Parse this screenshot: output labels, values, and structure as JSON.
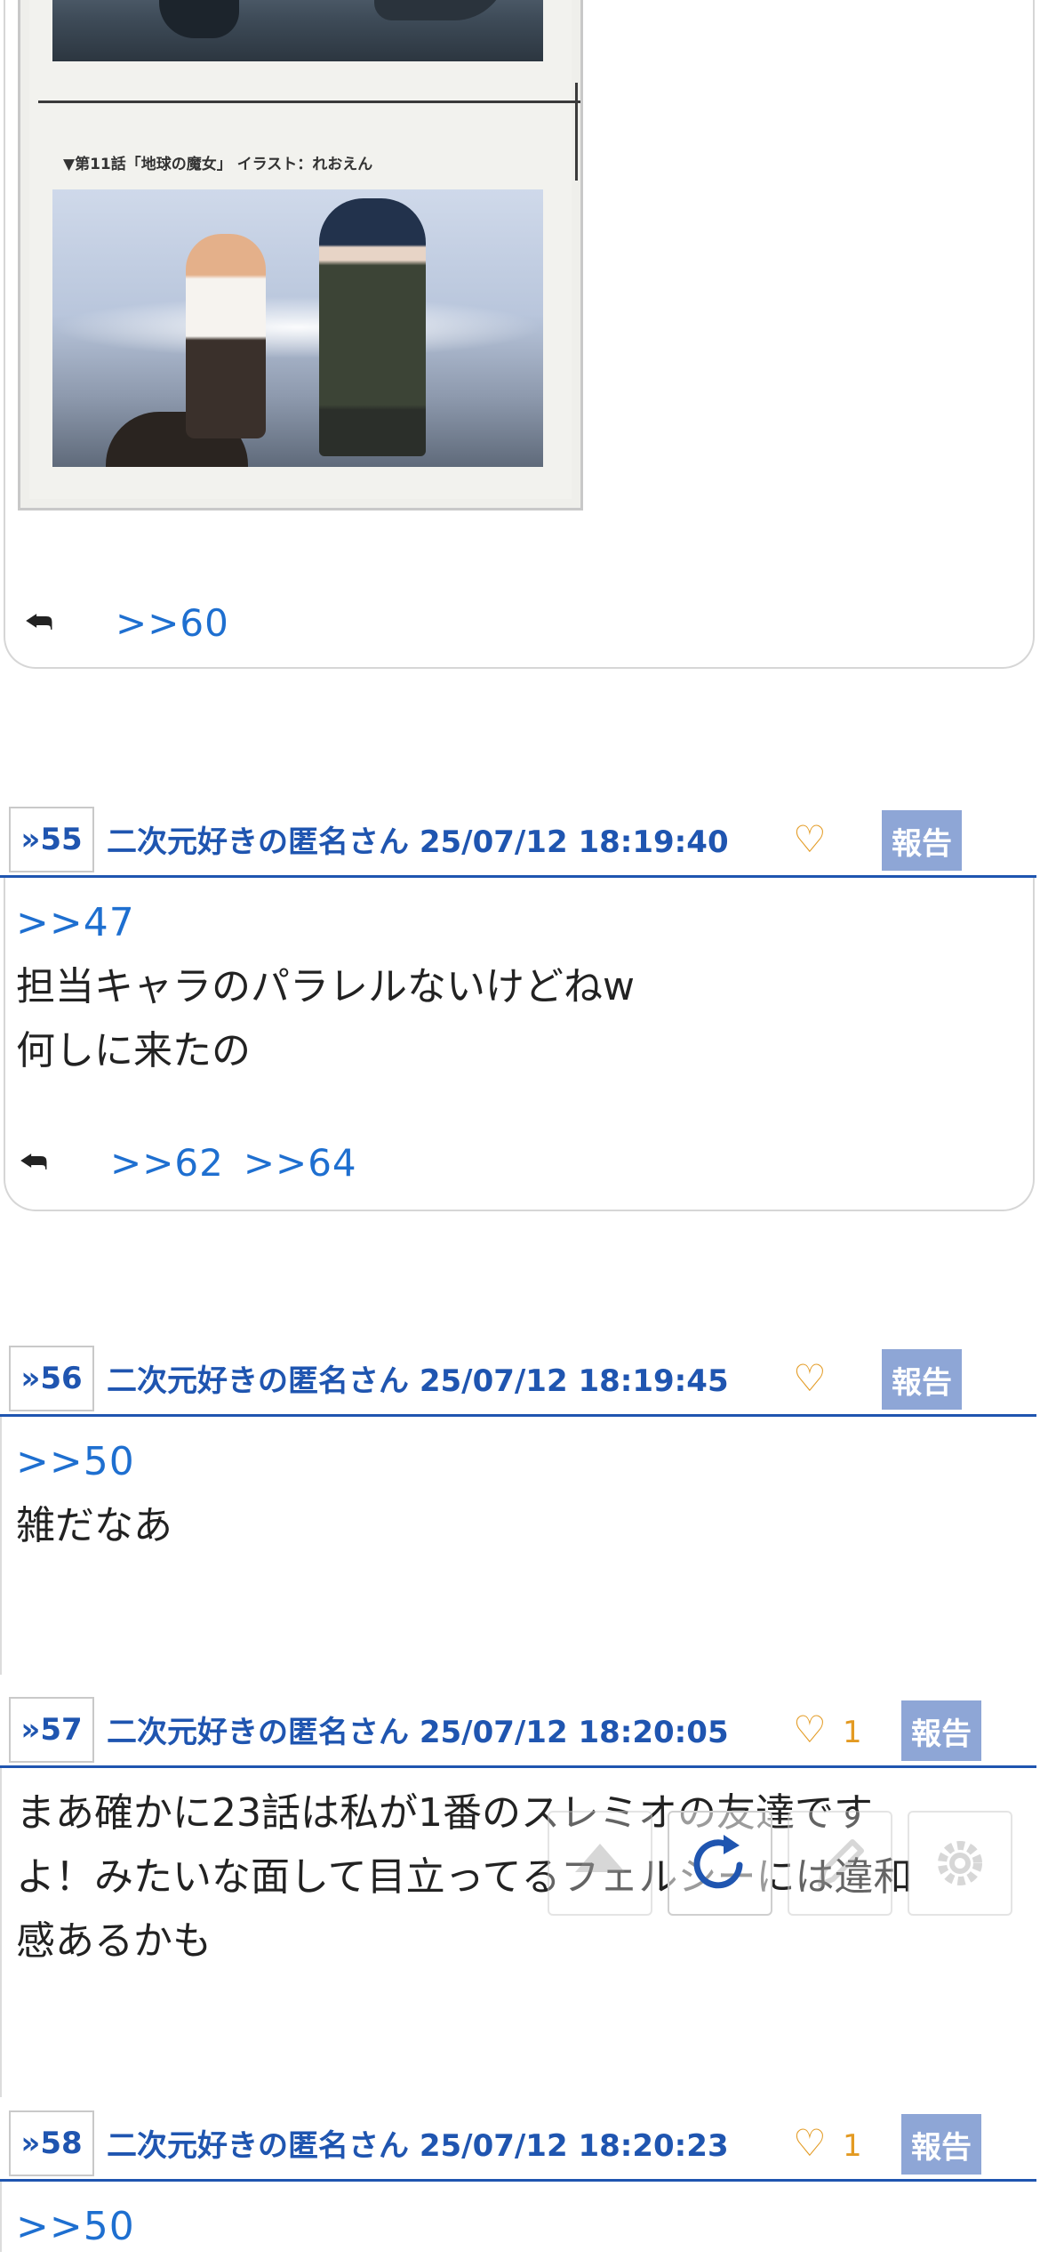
{
  "image_post": {
    "caption": "▼第11話「地球の魔女」 イラスト：れおえん",
    "replies": [
      ">>60"
    ]
  },
  "posts": [
    {
      "number": "»55",
      "author": "二次元好きの匿名さん",
      "datetime": "25/07/12 18:19:40",
      "likes": "",
      "report_label": "報告",
      "anchor": ">>47",
      "lines": [
        "担当キャラのパラレルないけどねw",
        "何しに来たの"
      ],
      "replies": [
        ">>62",
        ">>64"
      ]
    },
    {
      "number": "»56",
      "author": "二次元好きの匿名さん",
      "datetime": "25/07/12 18:19:45",
      "likes": "",
      "report_label": "報告",
      "anchor": ">>50",
      "lines": [
        "雑だなあ"
      ],
      "replies": []
    },
    {
      "number": "»57",
      "author": "二次元好きの匿名さん",
      "datetime": "25/07/12 18:20:05",
      "likes": "1",
      "report_label": "報告",
      "anchor": "",
      "lines": [
        "まあ確かに23話は私が1番のスレミオの友達です",
        "よ！みたいな面して目立ってるフェルシーには違和",
        "感あるかも"
      ],
      "replies": []
    },
    {
      "number": "»58",
      "author": "二次元好きの匿名さん",
      "datetime": "25/07/12 18:20:23",
      "likes": "1",
      "report_label": "報告",
      "anchor": ">>50",
      "lines": [],
      "replies": []
    }
  ],
  "toolbar": {
    "icons": [
      "arrow-up-icon",
      "refresh-icon",
      "pencil-icon",
      "gear-icon"
    ]
  },
  "colors": {
    "accent": "#1f55b0",
    "link": "#1e6fd0",
    "heart": "#e39a22",
    "report_bg": "#8ea6d6"
  }
}
